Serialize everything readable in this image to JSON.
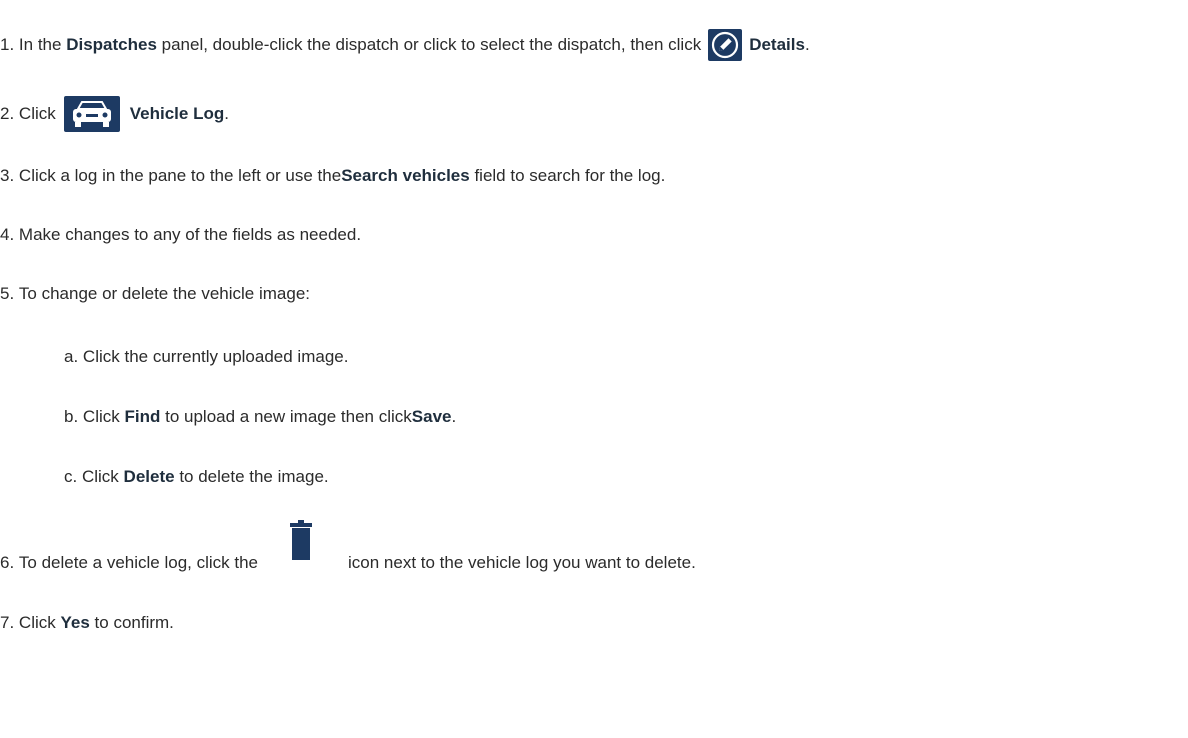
{
  "steps": [
    {
      "num": "1.",
      "pre": "In the",
      "bold1": "Dispatches",
      "mid": "panel, double-click the dispatch or click to select the dispatch, then click",
      "icon": "pencil-edit-icon",
      "bold2": "Details",
      "post": "."
    },
    {
      "num": "2.",
      "pre": "Click",
      "icon": "vehicle-car-icon",
      "bold1": "Vehicle Log",
      "post": "."
    },
    {
      "num": "3.",
      "pre": "Click a log in the pane to the left or use the",
      "bold1": "Search vehicles",
      "post": "field to search for the log."
    },
    {
      "num": "4.",
      "text": "Make changes to any of the fields as needed."
    },
    {
      "num": "5.",
      "text": "To change or delete the vehicle image:"
    },
    {
      "num": "a.",
      "text": "Click the currently uploaded image."
    },
    {
      "num": "b.",
      "pre": "Click",
      "bold1": "Find",
      "mid": "to upload a new image then click",
      "bold2": "Save",
      "post": "."
    },
    {
      "num": "c.",
      "pre": "Click",
      "bold1": "Delete",
      "post": "to delete the image."
    },
    {
      "num": "6.",
      "pre": "To delete a vehicle log, click the",
      "icon": "trash-delete-icon",
      "post": "icon next to the vehicle log you want to delete."
    },
    {
      "num": "7.",
      "pre": "Click",
      "bold1": "Yes",
      "post": "to confirm."
    }
  ],
  "colors": {
    "text": "#2b2b2b",
    "bold": "#1f2e3d",
    "icon_navy": "#1d3a63"
  }
}
